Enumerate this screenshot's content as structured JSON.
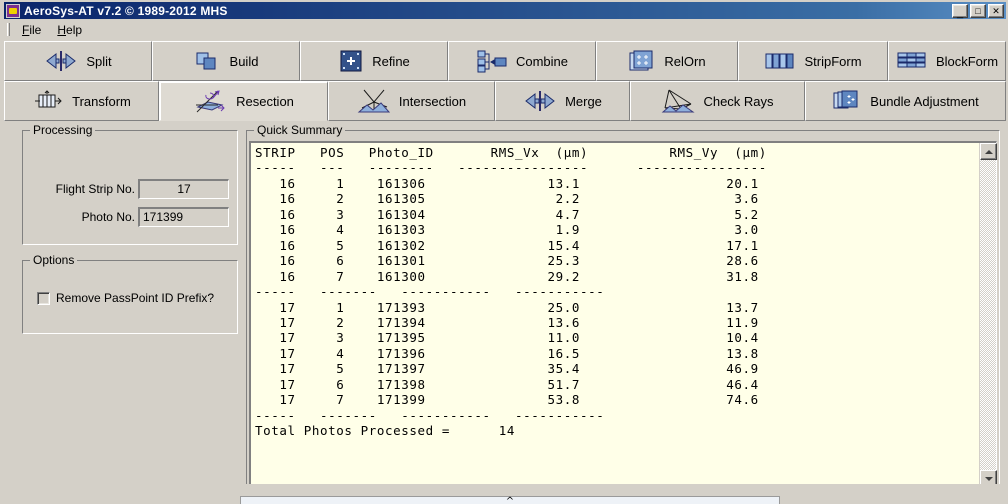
{
  "window": {
    "title": "AeroSys-AT  v7.2 © 1989-2012 MHS",
    "icon": "app-icon",
    "minimize_label": "_",
    "maximize_label": "□",
    "close_label": "✕"
  },
  "menubar": {
    "items": [
      {
        "label": "File",
        "accel": "F"
      },
      {
        "label": "Help",
        "accel": "H"
      }
    ]
  },
  "toolbar": {
    "row1": [
      {
        "label": "Split",
        "icon": "split-icon"
      },
      {
        "label": "Build",
        "icon": "build-icon"
      },
      {
        "label": "Refine",
        "icon": "refine-icon"
      },
      {
        "label": "Combine",
        "icon": "combine-icon"
      },
      {
        "label": "RelOrn",
        "icon": "relorn-icon"
      },
      {
        "label": "StripForm",
        "icon": "stripform-icon"
      },
      {
        "label": "BlockForm",
        "icon": "blockform-icon"
      }
    ],
    "row2": [
      {
        "label": "Transform",
        "icon": "transform-icon",
        "active": false
      },
      {
        "label": "Resection",
        "icon": "resection-icon",
        "active": true
      },
      {
        "label": "Intersection",
        "icon": "intersection-icon",
        "active": false
      },
      {
        "label": "Merge",
        "icon": "merge-icon",
        "active": false
      },
      {
        "label": "Check Rays",
        "icon": "check-rays-icon",
        "active": false
      },
      {
        "label": "Bundle Adjustment",
        "icon": "bundle-adjustment-icon",
        "active": false
      }
    ]
  },
  "processing": {
    "title": "Processing",
    "flight_strip_label": "Flight Strip No.",
    "flight_strip_value": "17",
    "photo_label": "Photo No.",
    "photo_value": "171399"
  },
  "options": {
    "title": "Options",
    "remove_prefix_label": "Remove PassPoint ID Prefix?",
    "remove_prefix_checked": false
  },
  "summary": {
    "title": "Quick Summary",
    "columns": [
      "STRIP",
      "POS",
      "Photo_ID",
      "RMS_Vx  (µm)",
      "RMS_Vy  (µm)"
    ],
    "rows": [
      {
        "strip": "16",
        "pos": "1",
        "photo_id": "161306",
        "rms_vx": "13.1",
        "rms_vy": "20.1"
      },
      {
        "strip": "16",
        "pos": "2",
        "photo_id": "161305",
        "rms_vx": "2.2",
        "rms_vy": "3.6"
      },
      {
        "strip": "16",
        "pos": "3",
        "photo_id": "161304",
        "rms_vx": "4.7",
        "rms_vy": "5.2"
      },
      {
        "strip": "16",
        "pos": "4",
        "photo_id": "161303",
        "rms_vx": "1.9",
        "rms_vy": "3.0"
      },
      {
        "strip": "16",
        "pos": "5",
        "photo_id": "161302",
        "rms_vx": "15.4",
        "rms_vy": "17.1"
      },
      {
        "strip": "16",
        "pos": "6",
        "photo_id": "161301",
        "rms_vx": "25.3",
        "rms_vy": "28.6"
      },
      {
        "strip": "16",
        "pos": "7",
        "photo_id": "161300",
        "rms_vx": "29.2",
        "rms_vy": "31.8"
      },
      {
        "strip": "17",
        "pos": "1",
        "photo_id": "171393",
        "rms_vx": "25.0",
        "rms_vy": "13.7"
      },
      {
        "strip": "17",
        "pos": "2",
        "photo_id": "171394",
        "rms_vx": "13.6",
        "rms_vy": "11.9"
      },
      {
        "strip": "17",
        "pos": "3",
        "photo_id": "171395",
        "rms_vx": "11.0",
        "rms_vy": "10.4"
      },
      {
        "strip": "17",
        "pos": "4",
        "photo_id": "171396",
        "rms_vx": "16.5",
        "rms_vy": "13.8"
      },
      {
        "strip": "17",
        "pos": "5",
        "photo_id": "171397",
        "rms_vx": "35.4",
        "rms_vy": "46.9"
      },
      {
        "strip": "17",
        "pos": "6",
        "photo_id": "171398",
        "rms_vx": "51.7",
        "rms_vy": "46.4"
      },
      {
        "strip": "17",
        "pos": "7",
        "photo_id": "171399",
        "rms_vx": "53.8",
        "rms_vy": "74.6"
      }
    ],
    "total_label": "Total Photos Processed =",
    "total_value": "14",
    "text": "STRIP   POS   Photo_ID       RMS_Vx  (µm)          RMS_Vy  (µm)\n-----   ---   --------   ----------------      ----------------\n   16     1    161306               13.1                  20.1\n   16     2    161305                2.2                   3.6\n   16     3    161304                4.7                   5.2\n   16     4    161303                1.9                   3.0\n   16     5    161302               15.4                  17.1\n   16     6    161301               25.3                  28.6\n   16     7    161300               29.2                  31.8\n-----   -------   -----------   -----------\n   17     1    171393               25.0                  13.7\n   17     2    171394               13.6                  11.9\n   17     3    171395               11.0                  10.4\n   17     4    171396               16.5                  13.8\n   17     5    171397               35.4                  46.9\n   17     6    171398               51.7                  46.4\n   17     7    171399               53.8                  74.6\n-----   -------   -----------   -----------\nTotal Photos Processed =      14"
  },
  "scrollbar": {
    "up_label": "▲",
    "down_label": "▼"
  },
  "bottom": {
    "caret": "^"
  },
  "colors": {
    "face": "#d4d0c8",
    "titlebar_start": "#0a246a",
    "titlebar_end": "#5a8fc5",
    "textarea_bg": "#ffffe8",
    "icon_blue": "#4a6fa5"
  }
}
